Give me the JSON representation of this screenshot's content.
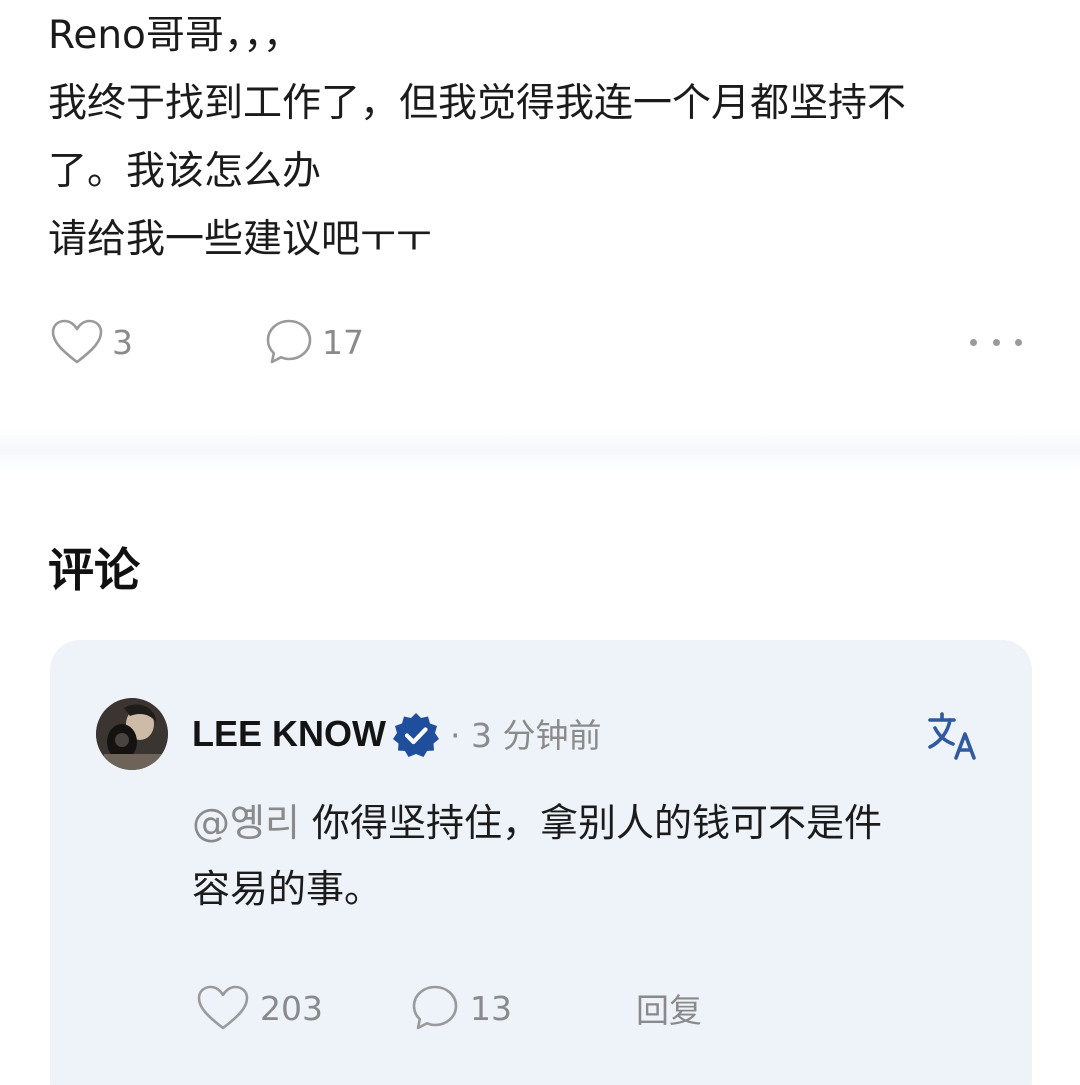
{
  "post": {
    "lines": [
      "Reno哥哥，，，",
      "我终于找到工作了，但我觉得我连一个月都坚持不",
      "了。我该怎么办",
      "请给我一些建议吧ㅜㅜ"
    ],
    "like_count": "3",
    "comment_count": "17"
  },
  "comments_heading": "评论",
  "comment": {
    "author": "LEE KNOW",
    "time": "· 3 分钟前",
    "mention": "@옝리",
    "body_line1": " 你得坚持住，拿别人的钱可不是件",
    "body_line2": "容易的事。",
    "like_count": "203",
    "comment_count": "13",
    "reply_label": "回复"
  },
  "colors": {
    "card_background": "#eef2f9",
    "verified_badge": "#1f4e9c",
    "translate_icon": "#2f5aa0",
    "secondary_text": "#8a8a8a"
  },
  "icons": [
    "heart-icon",
    "comment-bubble-icon",
    "more-icon",
    "verified-badge-icon",
    "translate-icon"
  ]
}
